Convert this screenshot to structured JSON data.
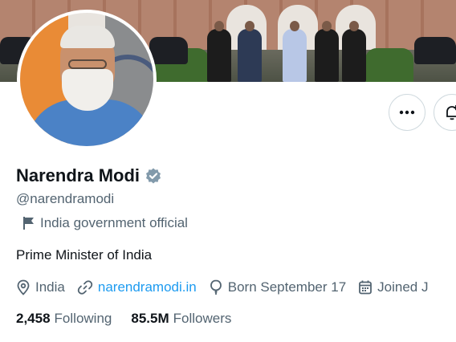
{
  "profile": {
    "display_name": "Narendra Modi",
    "handle": "@narendramodi",
    "affiliation": "India government official",
    "bio": "Prime Minister of India",
    "verified": true
  },
  "meta": {
    "location": "India",
    "website": "narendramodi.in",
    "birthday": "Born September 17",
    "joined": "Joined J"
  },
  "stats": {
    "following_count": "2,458",
    "following_label": "Following",
    "followers_count": "85.5M",
    "followers_label": "Followers"
  },
  "icons": {
    "more": "more-icon",
    "notify": "bell-plus-icon",
    "verified": "verified-badge-icon",
    "affiliation": "flag-icon",
    "location": "location-pin-icon",
    "website": "link-icon",
    "birthday": "balloon-icon",
    "joined": "calendar-icon"
  },
  "colors": {
    "link": "#1d9bf0",
    "secondary_text": "#536471",
    "verified_badge": "#829aab",
    "text": "#0f1419"
  }
}
